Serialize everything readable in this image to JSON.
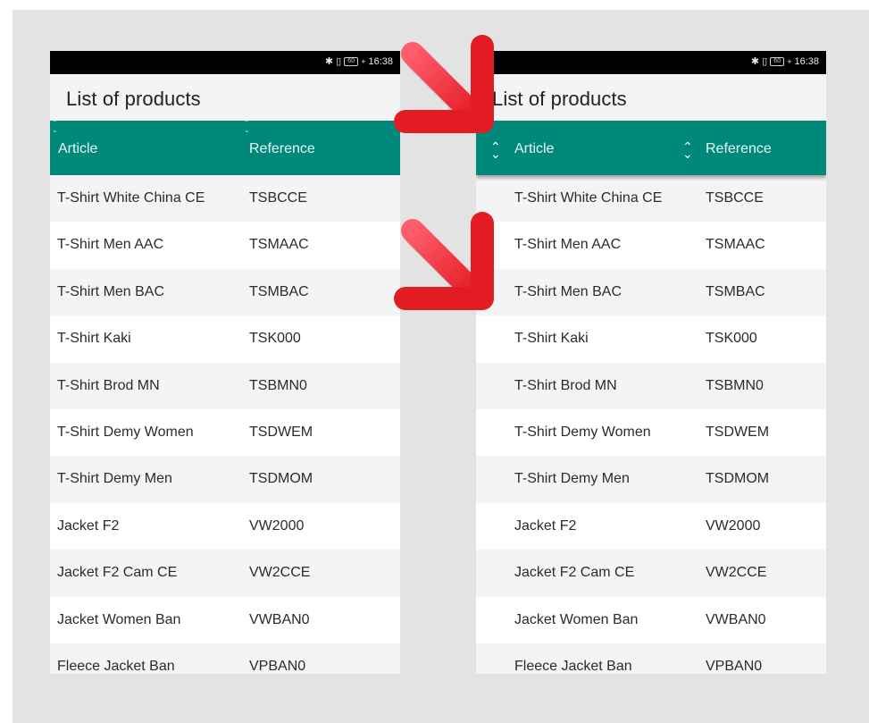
{
  "status_bar": {
    "time": "16:38",
    "battery": "60",
    "icons": [
      "bluetooth-icon",
      "vibrate-icon",
      "battery-icon",
      "charging-icon"
    ]
  },
  "title": "List of products",
  "columns": {
    "article": "Article",
    "reference": "Reference"
  },
  "products": [
    {
      "article": "T-Shirt White China CE",
      "reference": "TSBCCE"
    },
    {
      "article": "T-Shirt Men AAC",
      "reference": "TSMAAC"
    },
    {
      "article": "T-Shirt Men BAC",
      "reference": "TSMBAC"
    },
    {
      "article": "T-Shirt Kaki",
      "reference": "TSK000"
    },
    {
      "article": "T-Shirt Brod MN",
      "reference": "TSBMN0"
    },
    {
      "article": "T-Shirt Demy Women",
      "reference": "TSDWEM"
    },
    {
      "article": "T-Shirt Demy Men",
      "reference": "TSDMOM"
    },
    {
      "article": "Jacket F2",
      "reference": "VW2000"
    },
    {
      "article": "Jacket F2 Cam CE",
      "reference": "VW2CCE"
    },
    {
      "article": "Jacket Women Ban",
      "reference": "VWBAN0"
    },
    {
      "article": "Fleece Jacket Ban",
      "reference": "VPBAN0"
    }
  ],
  "colors": {
    "header": "#00897b",
    "arrow": "#e31b23",
    "arrow_highlight": "#ff5c6c",
    "row_alt": "#f4f4f4"
  }
}
